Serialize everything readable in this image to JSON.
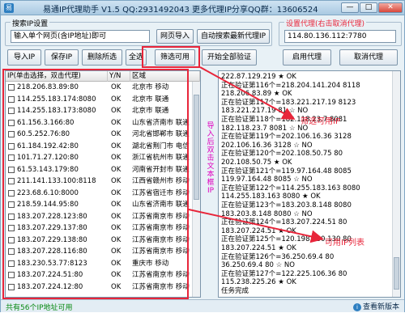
{
  "window": {
    "title": "易通IP代理助手 V1.5  QQ:2931492043  更多代理IP分享QQ群：13606524",
    "min": "—",
    "max": "□",
    "close": "✕"
  },
  "search_group": {
    "label": "搜索IP设置",
    "url_input": "输入单个网页(含IP地址)即可",
    "fetch_button": "网页导入",
    "auto_search_button": "自动搜索最新代理IP"
  },
  "proxy_group": {
    "label": "设置代理(右击取消代理)",
    "proxy_value": "114.80.136.112:7780"
  },
  "toolbar": {
    "import": "导入IP",
    "save": "保存IP",
    "delete": "删除所选",
    "select_all": "全选",
    "filter": "筛选可用",
    "verify_all": "开始全部验证",
    "enable_proxy": "启用代理",
    "cancel_proxy": "取消代理"
  },
  "list": {
    "headers": [
      "IP(单击选择，双击代理)",
      "Y/N",
      "区域"
    ],
    "rows": [
      {
        "ip": "218.206.83.89:80",
        "yn": "OK",
        "area": "北京市 移动"
      },
      {
        "ip": "114.255.183.174:8080",
        "yn": "OK",
        "area": "北京市 联通"
      },
      {
        "ip": "114.255.183.173:8080",
        "yn": "OK",
        "area": "北京市 联通"
      },
      {
        "ip": "61.156.3.166:80",
        "yn": "OK",
        "area": "山东省济南市 联通"
      },
      {
        "ip": "60.5.252.76:80",
        "yn": "OK",
        "area": "河北省邯郸市 联通"
      },
      {
        "ip": "61.184.192.42:80",
        "yn": "OK",
        "area": "湖北省荆门市 电信"
      },
      {
        "ip": "101.71.27.120:80",
        "yn": "OK",
        "area": "浙江省杭州市 联通"
      },
      {
        "ip": "61.53.143.179:80",
        "yn": "OK",
        "area": "河南省开封市 联通"
      },
      {
        "ip": "211.141.133.100:8118",
        "yn": "OK",
        "area": "江西省赣州市 移动"
      },
      {
        "ip": "223.68.6.10:8000",
        "yn": "OK",
        "area": "江苏省宿迁市 移动"
      },
      {
        "ip": "218.59.144.95:80",
        "yn": "OK",
        "area": "山东省济南市 联通"
      },
      {
        "ip": "183.207.228.123:80",
        "yn": "OK",
        "area": "江苏省南京市 移动"
      },
      {
        "ip": "183.207.229.137:80",
        "yn": "OK",
        "area": "江苏省南京市 移动"
      },
      {
        "ip": "183.207.229.138:80",
        "yn": "OK",
        "area": "江苏省南京市 移动"
      },
      {
        "ip": "183.207.228.116:80",
        "yn": "OK",
        "area": "江苏省南京市 移动"
      },
      {
        "ip": "183.230.53.77:8123",
        "yn": "OK",
        "area": "重庆市 移动"
      },
      {
        "ip": "183.207.224.51:80",
        "yn": "OK",
        "area": "江苏省南京市 移动"
      },
      {
        "ip": "183.207.224.12:80",
        "yn": "OK",
        "area": "江苏省南京市 移动"
      }
    ]
  },
  "sidebar_note": "导入后双击文本框IP",
  "log": {
    "lines": [
      "222.87.129.219    ★ OK",
      "正在验证第116个=218.204.141.204 8118",
      "218.206.83.89   ★ OK",
      "正在验证第117个=183.221.217.19 8123",
      "183.221.217.19 81  ☆ NO",
      "正在验证第118个=182.118.23.7 8081",
      "182.118.23.7 8081   ☆ NO",
      "正在验证第119个=202.106.16.36 3128",
      "202.106.16.36 3128   ☆ NO",
      "正在验证第120个=202.108.50.75 80",
      "202.108.50.75   ★ OK",
      "正在验证第121个=119.97.164.48 8085",
      "119.97.164.48 8085   ☆ NO",
      "正在验证第122个=114.255.183.163 8080",
      "114.255.183.163 8080   ★ OK",
      "正在验证第123个=183.203.8.148 8080",
      "183.203.8.148 8080   ☆ NO",
      "正在验证第124个=183.207.224.51 80",
      "183.207.224.51   ★ OK",
      "正在验证第125个=120.198.230.130 80",
      "183.207.224.51   ★ OK",
      "正在验证第126个=36.250.69.4 80",
      "36.250.69.4 80   ☆ NO",
      "正在验证第127个=122.225.106.36 80",
      "115.238.225.26   ★ OK",
      "任务完成"
    ]
  },
  "status": {
    "count_text": "共有56个IP地址可用",
    "help_label": "查看新版本"
  },
  "annotations": {
    "filter_label": "筛选可用IP",
    "list_label": "可用IP列表",
    "color": "#e8253a"
  }
}
